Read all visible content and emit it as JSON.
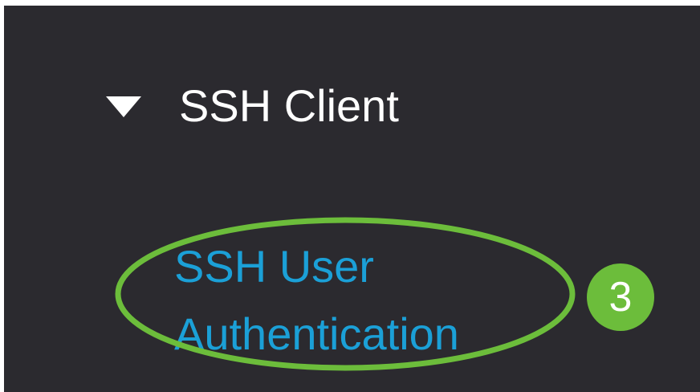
{
  "nav": {
    "section": {
      "label": "SSH Client",
      "expanded": true,
      "icon": "caret-down-icon"
    },
    "items": [
      {
        "label_lines": [
          "SSH User",
          "Authentication"
        ],
        "highlighted": true
      }
    ]
  },
  "annotation": {
    "step_number": "3",
    "ring_color": "#6cbd3b",
    "badge_color": "#6cbd3b"
  },
  "colors": {
    "panel_bg": "#2b2a2f",
    "header_text": "#ffffff",
    "link_text": "#1ba0d7"
  }
}
